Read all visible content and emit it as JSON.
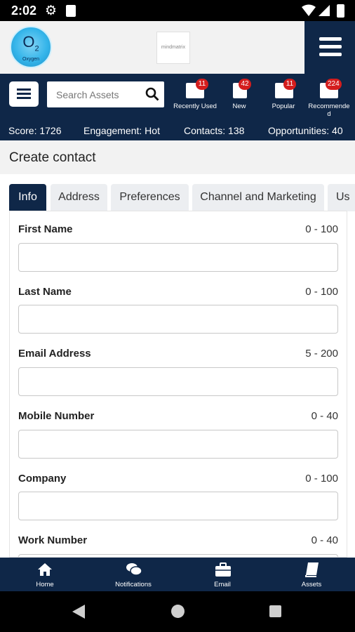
{
  "status_bar": {
    "time": "2:02"
  },
  "header": {
    "logo_text": "O",
    "logo_sub": "2",
    "logo_caption": "Oxygen",
    "partner_logo_text": "mindmatrix"
  },
  "toolbar": {
    "search_placeholder": "Search Assets",
    "items": [
      {
        "label": "Recently Used",
        "badge": "11",
        "icon": "folder-clock-icon"
      },
      {
        "label": "New",
        "badge": "42",
        "icon": "document-new-icon"
      },
      {
        "label": "Popular",
        "badge": "11",
        "icon": "briefcase-icon"
      },
      {
        "label": "Recommended",
        "badge": "224",
        "icon": "folder-open-icon"
      }
    ]
  },
  "stats": {
    "score": "Score: 1726",
    "engagement": "Engagement: Hot",
    "contacts": "Contacts: 138",
    "opportunities": "Opportunities: 40"
  },
  "page_title": "Create contact",
  "tabs": [
    {
      "label": "Info",
      "active": true
    },
    {
      "label": "Address",
      "active": false
    },
    {
      "label": "Preferences",
      "active": false
    },
    {
      "label": "Channel and Marketing",
      "active": false
    },
    {
      "label": "Us",
      "active": false
    }
  ],
  "form": {
    "fields": [
      {
        "label": "First Name",
        "range": "0 - 100",
        "value": ""
      },
      {
        "label": "Last Name",
        "range": "0 - 100",
        "value": ""
      },
      {
        "label": "Email Address",
        "range": "5 - 200",
        "value": ""
      },
      {
        "label": "Mobile Number",
        "range": "0 - 40",
        "value": ""
      },
      {
        "label": "Company",
        "range": "0 - 100",
        "value": ""
      },
      {
        "label": "Work Number",
        "range": "0 - 40",
        "value": ""
      }
    ]
  },
  "bottom_nav": [
    {
      "label": "Home",
      "icon": "home-icon"
    },
    {
      "label": "Notifications",
      "icon": "chat-bubbles-icon"
    },
    {
      "label": "Email",
      "icon": "briefcase-icon"
    },
    {
      "label": "Assets",
      "icon": "book-icon"
    }
  ],
  "colors": {
    "primary": "#0f2748",
    "badge": "#d41d1d",
    "header_bg": "#f2f2f2"
  }
}
